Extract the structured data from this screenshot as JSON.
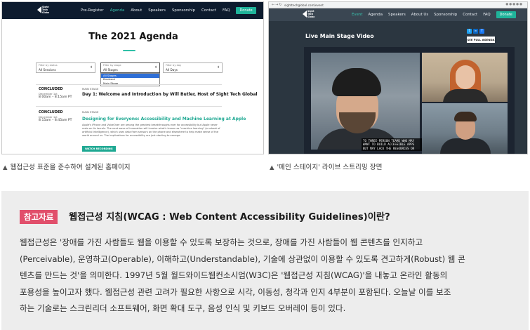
{
  "left_screenshot": {
    "nav": {
      "logo": "Sight Tech Global",
      "links": [
        "Pre-Register",
        "Agenda",
        "About",
        "Speakers",
        "Sponsorship",
        "Contact",
        "FAQ"
      ],
      "donate": "Donate"
    },
    "title": "The 2021 Agenda",
    "filters": [
      {
        "label": "Filter by status",
        "value": "All Sessions"
      },
      {
        "label": "Filter by stage",
        "value": "All Stages"
      },
      {
        "label": "Filter by day",
        "value": "All Days"
      }
    ],
    "stage_options": [
      "All Stages",
      "Breakout",
      "Main Stage"
    ],
    "sessions": [
      {
        "status": "CONCLUDED",
        "date": "December 1st",
        "time": "8:00am – 8:15am PT",
        "stage": "MAIN STAGE",
        "title": "Day 1: Welcome and Introduction by Will Butler, Host of Sight Tech Global"
      },
      {
        "status": "CONCLUDED",
        "date": "December 1st",
        "time": "8:15am – 8:45am PT",
        "stage": "MAIN STAGE",
        "title": "Designing for Everyone: Accessibility and Machine Learning at Apple",
        "description": "Apple's iPhone and VoiceOver are among the greatest breakthroughs ever for accessibility but Apple never rests on its laurels. The next wave of innovation will involve what's known as \"machine learning\" (a subset of artificial intelligence), which uses data from sensors on the phone and elsewhere to help make sense of the world around us. The implications for accessibility are just starting to emerge.",
        "button": "WATCH RECORDING"
      }
    ]
  },
  "right_screenshot": {
    "url": "sighttechglobal.com/event",
    "nav": {
      "logo": "Sight Tech Global",
      "links": [
        "Event",
        "Agenda",
        "Speakers",
        "About Us",
        "Sponsorship",
        "Contact",
        "FAQ"
      ],
      "donate": "Donate"
    },
    "title": "Live Main Stage Video",
    "full_agenda_button": "SEE FULL AGENDA",
    "social": [
      "t",
      "in",
      "f"
    ],
    "video_caption": "TO THREE-PERSON TEAMS WHO MAY WANT TO BUILD ACCESSIBLE APPS BUT MAY LACK THE RESOURCES OR"
  },
  "captions": {
    "left": "웹접근성 표준을 준수하여 설계된 홈페이지",
    "right": "'메인 스테이지' 라이브 스트리밍 장면"
  },
  "reference": {
    "badge": "참고자료",
    "title": "웹접근성 지침(WCAG : Web Content Accessibility Guidelines)이란?",
    "lines": [
      "웹접근성은 '장애를 가진 사람들도 웹을 이용할 수 있도록 보장하는 것으로, 장애를 가진 사람들이 웹 콘텐츠를 인지하고",
      "(Perceivable), 운영하고(Operable), 이해하고(Understandable), 기술에 상관없이 이용할 수 있도록 견고하게(Robust) 웹 콘",
      "텐츠를 만드는 것'을 의미한다. 1997년 5월 월드와이드웹컨소시엄(W3C)은 '웹접근성 지침(WCAG)'을 내놓고 온라인 활동의",
      "포용성을 높이고자 했다. 웹접근성 관련 고려가 필요한 사항으로 시각, 이동성, 청각과 인지 4부분이 포함된다. 오늘날 이를 보조",
      "하는 기술로는 스크린리더 소프트웨어, 화면 확대 도구, 음성 인식 및 키보드 오버레이 등이 있다."
    ]
  },
  "colors": {
    "accent_teal": "#1ea892",
    "badge_pink": "#e14f6b",
    "nav_dark": "#0d1b2e",
    "box_gray": "#ededed"
  }
}
